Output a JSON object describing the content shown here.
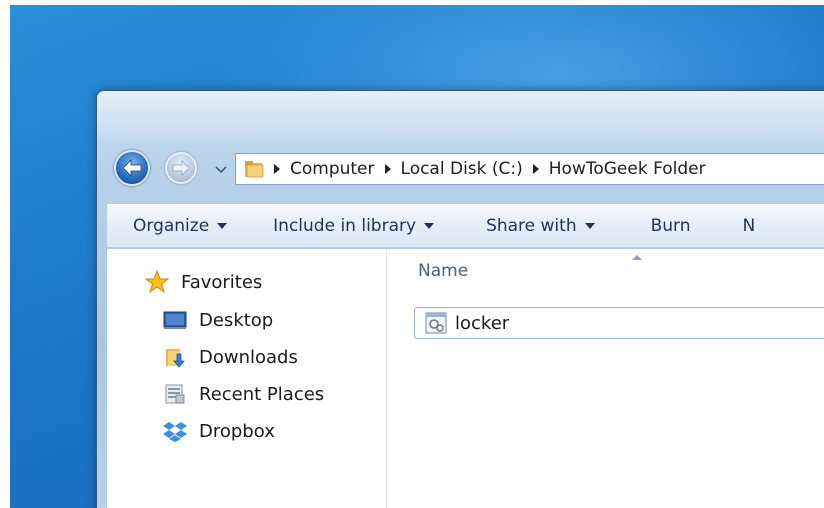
{
  "address_bar": {
    "crumbs": [
      "Computer",
      "Local Disk (C:)",
      "HowToGeek Folder"
    ]
  },
  "toolbar": {
    "organize": "Organize",
    "include_in_library": "Include in library",
    "share_with": "Share with",
    "burn": "Burn",
    "new_folder_partial": "N"
  },
  "nav_pane": {
    "favorites": "Favorites",
    "items": [
      "Desktop",
      "Downloads",
      "Recent Places",
      "Dropbox"
    ]
  },
  "file_list": {
    "column_name": "Name",
    "files": [
      {
        "name": "locker",
        "icon": "batch-file-icon"
      }
    ]
  },
  "colors": {
    "desktop_blue": "#1d78c9",
    "toolbar_text": "#1e3455",
    "selection_border": "#9ab2cd"
  }
}
